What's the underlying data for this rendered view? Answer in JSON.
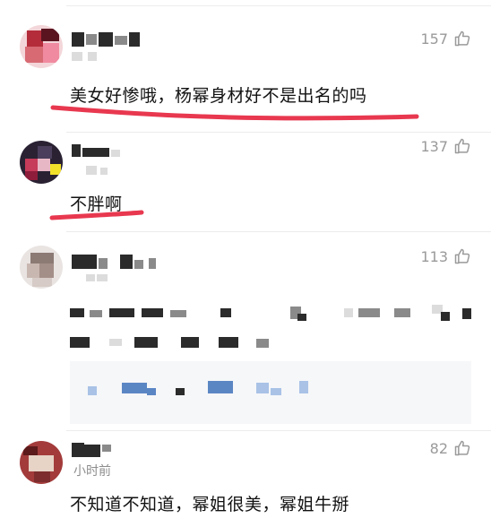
{
  "comments": [
    {
      "likes": "157",
      "text": "美女好惨哦，杨幂身材好不是出名的吗"
    },
    {
      "likes": "137",
      "text": "不胖啊"
    },
    {
      "likes": "113",
      "text": ""
    },
    {
      "likes": "82",
      "text": "不知道不知道，幂姐很美，幂姐牛掰",
      "time": "小时前"
    }
  ],
  "colors": {
    "underline": "#e8384f",
    "meta": "#9a9a9a"
  }
}
